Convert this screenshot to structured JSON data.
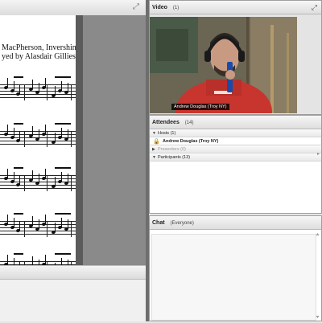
{
  "share": {
    "credit_line1": "MacPherson, Invershin.",
    "credit_line2": "yed by Alasdair Gillies."
  },
  "video": {
    "title": "Video",
    "count": "(1)",
    "nametag": "Andrew Douglas (Troy NY)"
  },
  "attendees": {
    "title": "Attendees",
    "count": "(14)",
    "groups": [
      {
        "label": "Hosts (1)",
        "members": [
          "Andrew Douglas (Troy NY)"
        ]
      },
      {
        "label": "Presenters (0)",
        "members": []
      },
      {
        "label": "Participants (13)",
        "members": []
      }
    ]
  },
  "chat": {
    "title": "Chat",
    "scope": "(Everyone)"
  },
  "colors": {
    "hoodie": "#c8352e",
    "accent_gray": "#7f7f7f"
  },
  "icons": [
    "fullscreen-icon",
    "host-lock-icon",
    "expand-triangle-icon"
  ]
}
